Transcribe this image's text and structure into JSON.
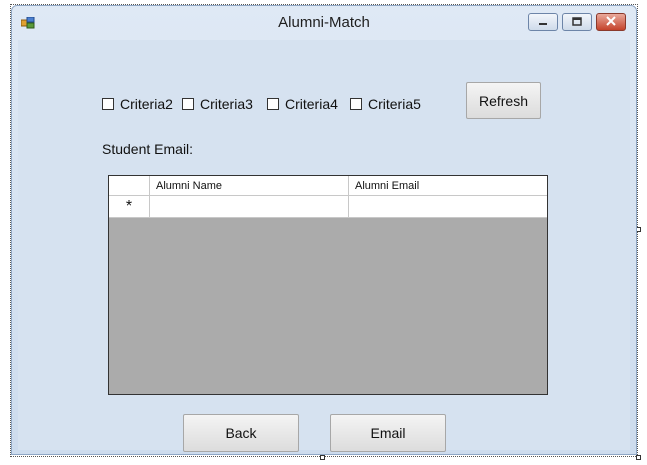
{
  "window": {
    "title": "Alumni-Match"
  },
  "criteria": [
    {
      "label": "Criteria2",
      "checked": false
    },
    {
      "label": "Criteria3",
      "checked": false
    },
    {
      "label": "Criteria4",
      "checked": false
    },
    {
      "label": "Criteria5",
      "checked": false
    }
  ],
  "buttons": {
    "refresh": "Refresh",
    "back": "Back",
    "email": "Email"
  },
  "student_email_label": "Student Email:",
  "grid": {
    "columns": [
      "Alumni Name",
      "Alumni Email"
    ],
    "new_row_marker": "*"
  },
  "icons": {
    "app": "app-form-icon",
    "minimize": "minimize-icon",
    "maximize": "maximize-icon",
    "close": "close-icon"
  },
  "colors": {
    "client_bg": "#d6e2f0",
    "grid_bg": "#ababab",
    "close_button": "#c4432b"
  }
}
